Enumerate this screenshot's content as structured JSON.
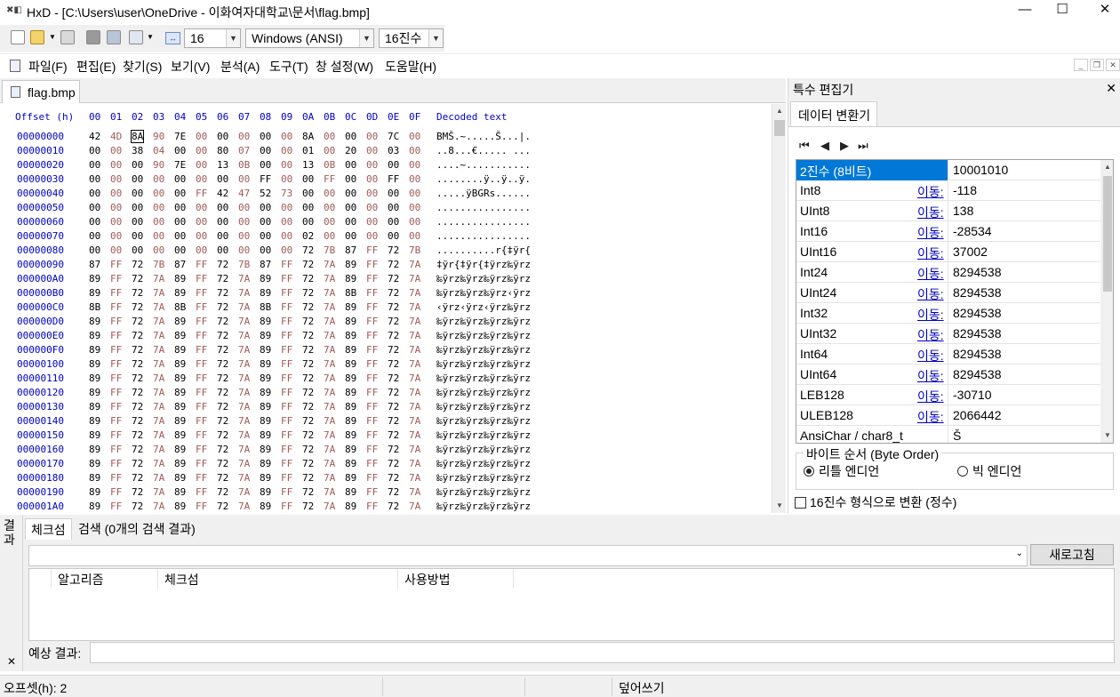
{
  "window": {
    "title": "HxD - [C:\\Users\\user\\OneDrive - 이화여자대학교\\문서\\flag.bmp]",
    "minimize": "—",
    "maximize": "☐",
    "close": "✕"
  },
  "toolbar": {
    "bytes_per_row": "16",
    "charset": "Windows (ANSI)",
    "offset_base": "16진수"
  },
  "menu": [
    "파일(F)",
    "편집(E)",
    "찾기(S)",
    "보기(V)",
    "분석(A)",
    "도구(T)",
    "창 설정(W)",
    "도움말(H)"
  ],
  "tab": {
    "label": "flag.bmp"
  },
  "hex": {
    "header_offset": "Offset (h)",
    "header_cols": [
      "00",
      "01",
      "02",
      "03",
      "04",
      "05",
      "06",
      "07",
      "08",
      "09",
      "0A",
      "0B",
      "0C",
      "0D",
      "0E",
      "0F"
    ],
    "header_text": "Decoded text",
    "rows": [
      {
        "offset": "00000000",
        "bytes": "42 4D 8A 90 7E 00 00 00 00 00 8A 00 00 00 7C 00",
        "text": "BMŠ.~.....Š...|."
      },
      {
        "offset": "00000010",
        "bytes": "00 00 38 04 00 00 80 07 00 00 01 00 20 00 03 00",
        "text": "..8...€..... ..."
      },
      {
        "offset": "00000020",
        "bytes": "00 00 00 90 7E 00 13 0B 00 00 13 0B 00 00 00 00",
        "text": "....~..........."
      },
      {
        "offset": "00000030",
        "bytes": "00 00 00 00 00 00 00 00 FF 00 00 FF 00 00 FF 00",
        "text": "........ÿ..ÿ..ÿ."
      },
      {
        "offset": "00000040",
        "bytes": "00 00 00 00 00 FF 42 47 52 73 00 00 00 00 00 00",
        "text": ".....ÿBGRs......"
      },
      {
        "offset": "00000050",
        "bytes": "00 00 00 00 00 00 00 00 00 00 00 00 00 00 00 00",
        "text": "................"
      },
      {
        "offset": "00000060",
        "bytes": "00 00 00 00 00 00 00 00 00 00 00 00 00 00 00 00",
        "text": "................"
      },
      {
        "offset": "00000070",
        "bytes": "00 00 00 00 00 00 00 00 00 00 02 00 00 00 00 00",
        "text": "................"
      },
      {
        "offset": "00000080",
        "bytes": "00 00 00 00 00 00 00 00 00 00 72 7B 87 FF 72 7B",
        "text": "..........r{‡ÿr{"
      },
      {
        "offset": "00000090",
        "bytes": "87 FF 72 7B 87 FF 72 7B 87 FF 72 7A 89 FF 72 7A",
        "text": "‡ÿr{‡ÿr{‡ÿrz‰ÿrz"
      },
      {
        "offset": "000000A0",
        "bytes": "89 FF 72 7A 89 FF 72 7A 89 FF 72 7A 89 FF 72 7A",
        "text": "‰ÿrz‰ÿrz‰ÿrz‰ÿrz"
      },
      {
        "offset": "000000B0",
        "bytes": "89 FF 72 7A 89 FF 72 7A 89 FF 72 7A 8B FF 72 7A",
        "text": "‰ÿrz‰ÿrz‰ÿrz‹ÿrz"
      },
      {
        "offset": "000000C0",
        "bytes": "8B FF 72 7A 8B FF 72 7A 8B FF 72 7A 89 FF 72 7A",
        "text": "‹ÿrz‹ÿrz‹ÿrz‰ÿrz"
      },
      {
        "offset": "000000D0",
        "bytes": "89 FF 72 7A 89 FF 72 7A 89 FF 72 7A 89 FF 72 7A",
        "text": "‰ÿrz‰ÿrz‰ÿrz‰ÿrz"
      },
      {
        "offset": "000000E0",
        "bytes": "89 FF 72 7A 89 FF 72 7A 89 FF 72 7A 89 FF 72 7A",
        "text": "‰ÿrz‰ÿrz‰ÿrz‰ÿrz"
      },
      {
        "offset": "000000F0",
        "bytes": "89 FF 72 7A 89 FF 72 7A 89 FF 72 7A 89 FF 72 7A",
        "text": "‰ÿrz‰ÿrz‰ÿrz‰ÿrz"
      },
      {
        "offset": "00000100",
        "bytes": "89 FF 72 7A 89 FF 72 7A 89 FF 72 7A 89 FF 72 7A",
        "text": "‰ÿrz‰ÿrz‰ÿrz‰ÿrz"
      },
      {
        "offset": "00000110",
        "bytes": "89 FF 72 7A 89 FF 72 7A 89 FF 72 7A 89 FF 72 7A",
        "text": "‰ÿrz‰ÿrz‰ÿrz‰ÿrz"
      },
      {
        "offset": "00000120",
        "bytes": "89 FF 72 7A 89 FF 72 7A 89 FF 72 7A 89 FF 72 7A",
        "text": "‰ÿrz‰ÿrz‰ÿrz‰ÿrz"
      },
      {
        "offset": "00000130",
        "bytes": "89 FF 72 7A 89 FF 72 7A 89 FF 72 7A 89 FF 72 7A",
        "text": "‰ÿrz‰ÿrz‰ÿrz‰ÿrz"
      },
      {
        "offset": "00000140",
        "bytes": "89 FF 72 7A 89 FF 72 7A 89 FF 72 7A 89 FF 72 7A",
        "text": "‰ÿrz‰ÿrz‰ÿrz‰ÿrz"
      },
      {
        "offset": "00000150",
        "bytes": "89 FF 72 7A 89 FF 72 7A 89 FF 72 7A 89 FF 72 7A",
        "text": "‰ÿrz‰ÿrz‰ÿrz‰ÿrz"
      },
      {
        "offset": "00000160",
        "bytes": "89 FF 72 7A 89 FF 72 7A 89 FF 72 7A 89 FF 72 7A",
        "text": "‰ÿrz‰ÿrz‰ÿrz‰ÿrz"
      },
      {
        "offset": "00000170",
        "bytes": "89 FF 72 7A 89 FF 72 7A 89 FF 72 7A 89 FF 72 7A",
        "text": "‰ÿrz‰ÿrz‰ÿrz‰ÿrz"
      },
      {
        "offset": "00000180",
        "bytes": "89 FF 72 7A 89 FF 72 7A 89 FF 72 7A 89 FF 72 7A",
        "text": "‰ÿrz‰ÿrz‰ÿrz‰ÿrz"
      },
      {
        "offset": "00000190",
        "bytes": "89 FF 72 7A 89 FF 72 7A 89 FF 72 7A 89 FF 72 7A",
        "text": "‰ÿrz‰ÿrz‰ÿrz‰ÿrz"
      },
      {
        "offset": "000001A0",
        "bytes": "89 FF 72 7A 89 FF 72 7A 89 FF 72 7A 89 FF 72 7A",
        "text": "‰ÿrz‰ÿrz‰ÿrz‰ÿrz"
      }
    ]
  },
  "special_editor": {
    "title": "특수 편집기",
    "close": "✕",
    "tab": "데이터 변환기",
    "nav": [
      "⏮",
      "◀",
      "▶",
      "⏭"
    ],
    "goto_label": "이동:",
    "rows": [
      {
        "type": "2진수 (8비트)",
        "value": "10001010",
        "selected": true,
        "goto": false
      },
      {
        "type": "Int8",
        "value": "-118",
        "goto": true
      },
      {
        "type": "UInt8",
        "value": "138",
        "goto": true
      },
      {
        "type": "Int16",
        "value": "-28534",
        "goto": true
      },
      {
        "type": "UInt16",
        "value": "37002",
        "goto": true
      },
      {
        "type": "Int24",
        "value": "8294538",
        "goto": true
      },
      {
        "type": "UInt24",
        "value": "8294538",
        "goto": true
      },
      {
        "type": "Int32",
        "value": "8294538",
        "goto": true
      },
      {
        "type": "UInt32",
        "value": "8294538",
        "goto": true
      },
      {
        "type": "Int64",
        "value": "8294538",
        "goto": true
      },
      {
        "type": "UInt64",
        "value": "8294538",
        "goto": true
      },
      {
        "type": "LEB128",
        "value": "-30710",
        "goto": true
      },
      {
        "type": "ULEB128",
        "value": "2066442",
        "goto": true
      },
      {
        "type": "AnsiChar / char8_t",
        "value": "Š",
        "goto": false
      }
    ],
    "byte_order": {
      "legend": "바이트 순서 (Byte Order)",
      "little": "리틀 엔디언",
      "big": "빅 엔디언",
      "selected": "little"
    },
    "hex_format": "16진수 형식으로 변환 (정수)"
  },
  "results": {
    "side_label": "결과",
    "tabs": [
      "체크섬",
      "검색 (0개의 검색 결과)"
    ],
    "refresh": "새로고침",
    "columns": [
      "알고리즘",
      "체크섬",
      "사용방법"
    ],
    "expected_label": "예상 결과:",
    "expected_value": ""
  },
  "status": {
    "offset": "오프셋(h): 2",
    "mode": "덮어쓰기"
  }
}
